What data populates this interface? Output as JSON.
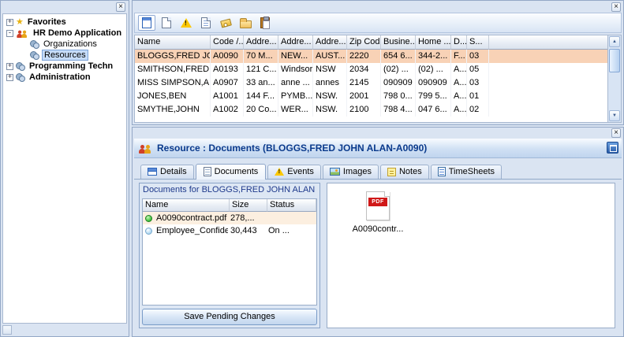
{
  "icons": {
    "close": "×",
    "scroll_up": "▲",
    "scroll_down": "▼",
    "warning_mark": "!",
    "star": "★",
    "pdf_label": "PDF"
  },
  "tree": {
    "items": [
      {
        "label": "Favorites",
        "level": 0,
        "expander": "+",
        "icon": "star",
        "bold": true
      },
      {
        "label": "HR Demo Application",
        "level": 0,
        "expander": "-",
        "icon": "people",
        "bold": true
      },
      {
        "label": "Organizations",
        "level": 1,
        "icon": "gear"
      },
      {
        "label": "Resources",
        "level": 1,
        "icon": "gear",
        "selected": true
      },
      {
        "label": "Programming Techn",
        "level": 0,
        "expander": "+",
        "icon": "gear",
        "bold": true
      },
      {
        "label": "Administration",
        "level": 0,
        "expander": "+",
        "icon": "gear",
        "bold": true
      }
    ]
  },
  "toolbar": {
    "buttons": [
      {
        "name": "new-record-icon",
        "type": "doc-framed",
        "pressed": true
      },
      {
        "name": "document-icon",
        "type": "page"
      },
      {
        "name": "warning-icon",
        "type": "warning"
      },
      {
        "name": "report-icon",
        "type": "page-lines"
      },
      {
        "name": "label-icon",
        "type": "tag"
      },
      {
        "name": "folder-icon",
        "type": "folder"
      },
      {
        "name": "paste-icon",
        "type": "clipboard"
      }
    ]
  },
  "grid": {
    "columns": [
      "Name",
      "Code /...",
      "Addre...",
      "Addre...",
      "Addre...",
      "Zip Code",
      "Busine...",
      "Home ...",
      "D...",
      "S..."
    ],
    "selected_row_index": 0,
    "rows": [
      [
        "BLOGGS,FRED JO...",
        "A0090",
        "70 M...",
        "NEW...",
        "AUST...",
        "2220",
        "654 6...",
        "344-2...",
        "F...",
        "03"
      ],
      [
        "SMITHSON,FRED",
        "A0193",
        "121 C...",
        "Windsor",
        "NSW",
        "2034",
        "(02) ...",
        "(02) ...",
        "A...",
        "05"
      ],
      [
        "MISS SIMPSON,A...",
        "A0907",
        "33 an...",
        "anne ...",
        "annes",
        "2145",
        "090909",
        "090909",
        "A...",
        "03"
      ],
      [
        "JONES,BEN",
        "A1001",
        "144 F...",
        "PYMB...",
        "NSW.",
        "2001",
        "798 0...",
        "799 5...",
        "A...",
        "01"
      ],
      [
        "SMYTHE,JOHN",
        "A1002",
        "20 Co...",
        "WER...",
        "NSW.",
        "2100",
        "798 4...",
        "047 6...",
        "A...",
        "02"
      ]
    ]
  },
  "detail": {
    "title": "Resource : Documents (BLOGGS,FRED JOHN ALAN-A0090)",
    "tabs": [
      {
        "label": "Details",
        "icon": "details"
      },
      {
        "label": "Documents",
        "icon": "document",
        "active": true
      },
      {
        "label": "Events",
        "icon": "warning"
      },
      {
        "label": "Images",
        "icon": "image"
      },
      {
        "label": "Notes",
        "icon": "note"
      },
      {
        "label": "TimeSheets",
        "icon": "timesheet"
      }
    ],
    "documents": {
      "group_title": "Documents for BLOGGS,FRED JOHN ALAN",
      "columns": [
        "Name",
        "Size",
        "Status"
      ],
      "rows": [
        {
          "name": "A0090contract.pdf",
          "size": "278,...",
          "status": "",
          "dot": "green",
          "selected": true
        },
        {
          "name": "Employee_Confide...",
          "size": "30,443",
          "status": "On ...",
          "dot": "blue"
        }
      ],
      "save_button_label": "Save Pending Changes"
    },
    "preview": {
      "file_label": "A0090contr..."
    }
  }
}
